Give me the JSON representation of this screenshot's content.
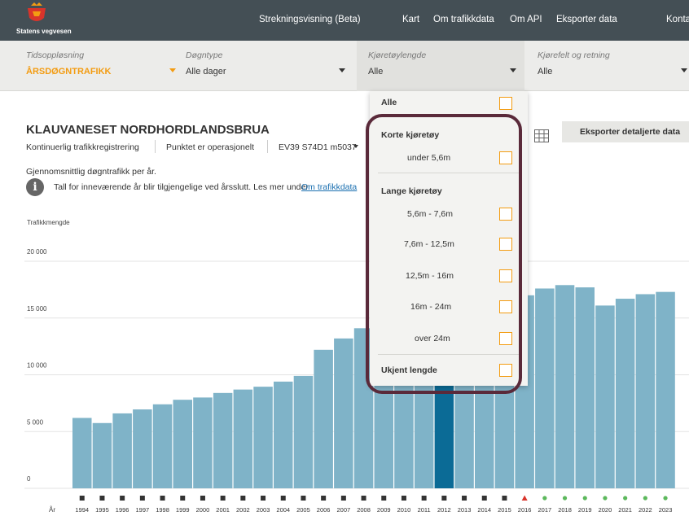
{
  "nav": {
    "logo_text": "Statens vegvesen",
    "links": [
      "Strekningsvisning (Beta)",
      "Kart",
      "Om trafikkdata",
      "Om API",
      "Eksporter data",
      "Konta"
    ]
  },
  "filters": [
    {
      "label": "Tidsoppløsning",
      "value": "ÅRSDØGNTRAFIKK"
    },
    {
      "label": "Døgntype",
      "value": "Alle dager"
    },
    {
      "label": "Kjøretøylengde",
      "value": "Alle"
    },
    {
      "label": "Kjørefelt og retning",
      "value": "Alle"
    }
  ],
  "station": {
    "title": "KLAUVANESET NORDHORDLANDSBRUA",
    "type": "Kontinuerlig trafikkregistrering",
    "status": "Punktet er operasjonelt",
    "road_ref": "EV39 S74D1 m5037"
  },
  "subtitle": "Gjennomsnittlig døgntrafikk per år.",
  "info": {
    "text": "Tall for inneværende år blir tilgjengelige ved årsslutt. Les mer under",
    "link": "Om trafikkdata"
  },
  "export_button": "Eksporter detaljerte data",
  "dropdown": {
    "all_label": "Alle",
    "short_header": "Korte kjøretøy",
    "short_items": [
      "under 5,6m"
    ],
    "long_header": "Lange kjøretøy",
    "long_items": [
      "5,6m - 7,6m",
      "7,6m - 12,5m",
      "12,5m - 16m",
      "16m - 24m",
      "over 24m"
    ],
    "unknown_label": "Ukjent lengde"
  },
  "colors": {
    "bar": "#7fb3c8",
    "bar_selected": "#0b6b96",
    "accent": "#f39c12",
    "marker_square": "#333333",
    "marker_triangle": "#d9342b",
    "marker_dot": "#5cb85c"
  },
  "chart_data": {
    "type": "bar",
    "ylabel": "Trafikkmengde",
    "xlabel": "År",
    "ylim": [
      0,
      20000
    ],
    "yticks": [
      0,
      5000,
      10000,
      15000,
      20000
    ],
    "ytick_labels": [
      "0",
      "5 000",
      "10 000",
      "15 000",
      "20 000"
    ],
    "grid": true,
    "categories": [
      "1994",
      "1995",
      "1996",
      "1997",
      "1998",
      "1999",
      "2000",
      "2001",
      "2002",
      "2003",
      "2004",
      "2005",
      "2006",
      "2007",
      "2008",
      "2009",
      "2010",
      "2011",
      "2012",
      "2013",
      "2014",
      "2015",
      "2016",
      "2017",
      "2018",
      "2019",
      "2020",
      "2021",
      "2022",
      "2023"
    ],
    "values": [
      6200,
      5750,
      6600,
      6950,
      7400,
      7800,
      8000,
      8400,
      8700,
      8950,
      9400,
      9900,
      12200,
      13200,
      14100,
      15000,
      15500,
      15900,
      16300,
      16700,
      16500,
      16700,
      17000,
      17600,
      17900,
      17700,
      16100,
      16700,
      17100,
      17300
    ],
    "selected_category": "2012",
    "markers": [
      "square",
      "square",
      "square",
      "square",
      "square",
      "square",
      "square",
      "square",
      "square",
      "square",
      "square",
      "square",
      "square",
      "square",
      "square",
      "square",
      "square",
      "square",
      "square",
      "square",
      "square",
      "square",
      "triangle",
      "dot",
      "dot",
      "dot",
      "dot",
      "dot",
      "dot",
      "dot"
    ]
  }
}
